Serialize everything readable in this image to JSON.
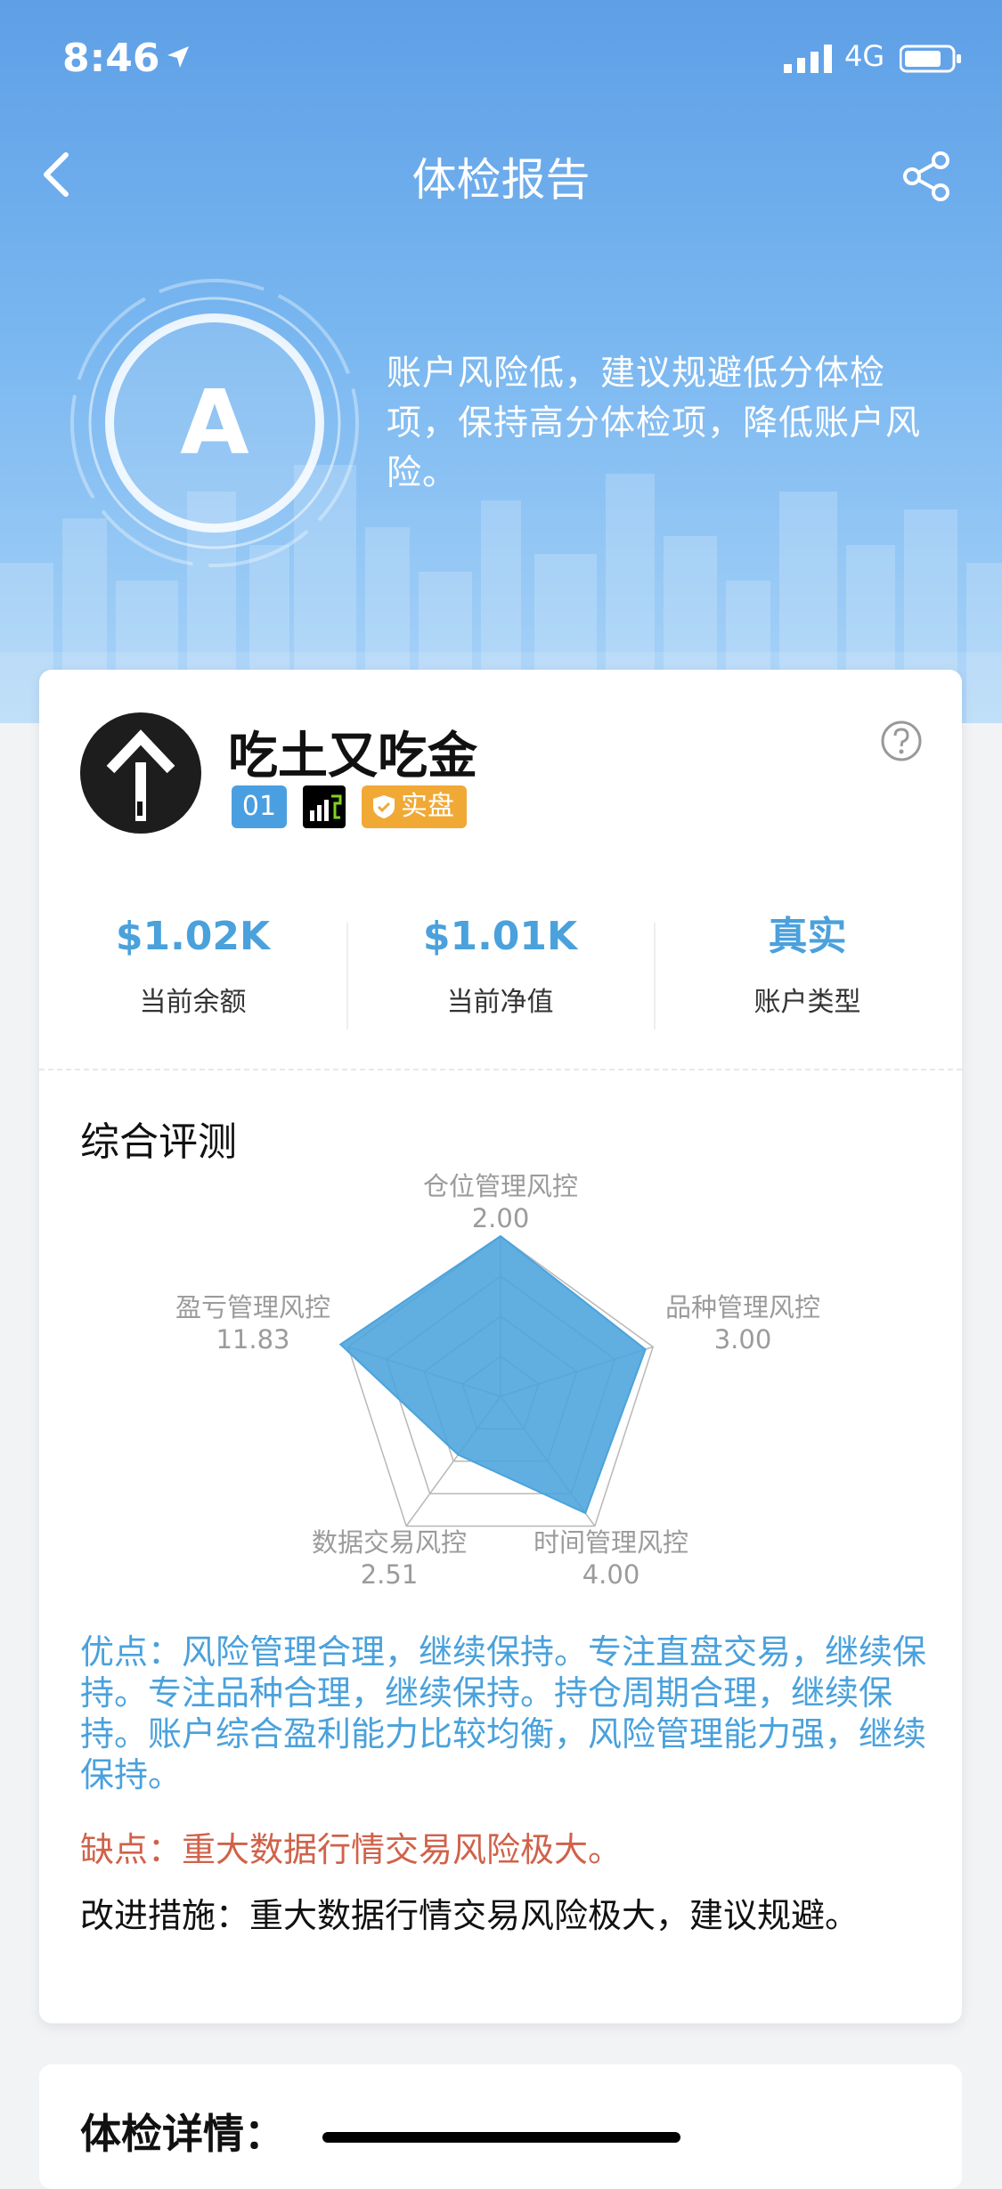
{
  "status": {
    "time": "8:46",
    "network": "4G"
  },
  "nav": {
    "title": "体检报告"
  },
  "grade": {
    "letter": "A",
    "summary": "账户风险低，建议规避低分体检项，保持高分体检项，降低账户风险。"
  },
  "profile": {
    "name": "吃土又吃金",
    "badge_number": "01",
    "badge_type": "实盘"
  },
  "stats": [
    {
      "value": "$1.02K",
      "label": "当前余额"
    },
    {
      "value": "$1.01K",
      "label": "当前净值"
    },
    {
      "value": "真实",
      "label": "账户类型"
    }
  ],
  "section_title": "综合评测",
  "chart_data": {
    "type": "radar",
    "axes": [
      "仓位管理风控",
      "品种管理风控",
      "时间管理风控",
      "数据交易风控",
      "盈亏管理风控"
    ],
    "value_labels": [
      "2.00",
      "3.00",
      "4.00",
      "2.51",
      "11.83"
    ],
    "fill_ratios": [
      1.0,
      0.95,
      0.9,
      0.45,
      1.05
    ],
    "fill_color": "#4ba3dc"
  },
  "advantages": "优点：风险管理合理，继续保持。专注直盘交易，继续保持。专注品种合理，继续保持。持仓周期合理，继续保持。账户综合盈利能力比较均衡，风险管理能力强，继续保持。",
  "disadvantages": "缺点：重大数据行情交易风险极大。",
  "improvement": "改进措施：重大数据行情交易风险极大，建议规避。",
  "detail_title": "体检详情："
}
